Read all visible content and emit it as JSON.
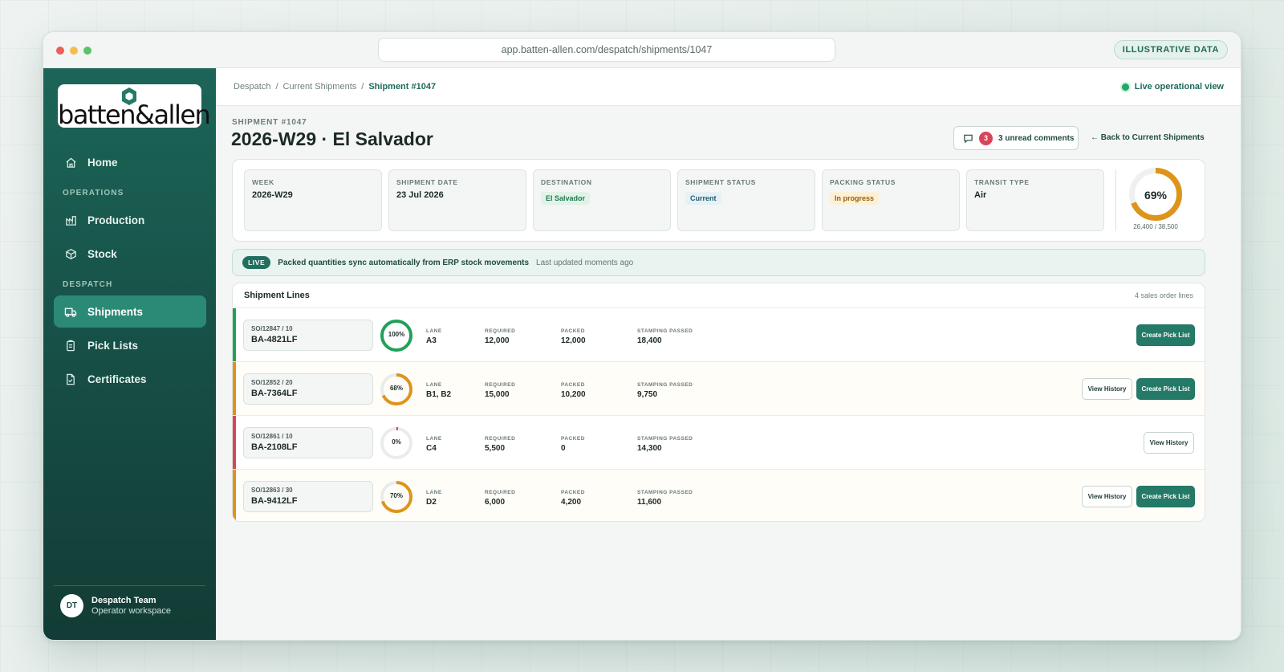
{
  "browser": {
    "url": "app.batten-allen.com/despatch/shipments/1047",
    "badge": "ILLUSTRATIVE DATA"
  },
  "brand": {
    "logo_text": "batten&allen",
    "accent": "#247a66"
  },
  "sidebar": {
    "items": [
      {
        "label": "Home",
        "icon": "home-icon"
      },
      {
        "label": "Production",
        "icon": "factory-icon"
      },
      {
        "label": "Stock",
        "icon": "box-icon"
      },
      {
        "label": "Shipments",
        "icon": "truck-icon",
        "active": true
      },
      {
        "label": "Pick Lists",
        "icon": "clipboard-icon"
      },
      {
        "label": "Certificates",
        "icon": "certificate-icon"
      }
    ],
    "sections": {
      "operations": "OPERATIONS",
      "despatch": "DESPATCH"
    },
    "user": {
      "initials": "DT",
      "name": "Despatch Team",
      "role": "Operator workspace"
    }
  },
  "topbar": {
    "breadcrumb": [
      "Despatch",
      "Current Shipments",
      "Shipment #1047"
    ],
    "live_view": "Live operational view"
  },
  "shipment": {
    "label": "SHIPMENT #1047",
    "title": "2026-W29 · El Salvador",
    "comments_count": "3",
    "comments_label": "3 unread comments",
    "back_label": "← Back to Current Shipments",
    "info": {
      "week_key": "WEEK",
      "week": "2026-W29",
      "date_key": "SHIPMENT DATE",
      "date": "23 Jul 2026",
      "dest_key": "DESTINATION",
      "dest": "El Salvador",
      "status_key": "SHIPMENT STATUS",
      "status": "Current",
      "packing_key": "PACKING STATUS",
      "packing": "In progress",
      "transit_key": "TRANSIT TYPE",
      "transit": "Air"
    },
    "progress": {
      "percent_label": "69%",
      "percent": 0.69,
      "detail": "26,400 / 38,500"
    }
  },
  "live_banner": {
    "pill": "LIVE",
    "message": "Packed quantities sync automatically from ERP stock movements",
    "updated": "Last updated moments ago"
  },
  "lines": {
    "title": "Shipment Lines",
    "count": "4 sales order lines",
    "headers": {
      "lane": "LANE",
      "required": "REQUIRED",
      "packed": "PACKED",
      "stamping": "STAMPING PASSED"
    },
    "view_history": "View History",
    "create_pick": "Create Pick List",
    "rows": [
      {
        "so": "SO/12847 / 10",
        "code": "BA-4821LF",
        "pct_label": "100%",
        "pct": 1.0,
        "lane": "A3",
        "required": "12,000",
        "packed": "12,000",
        "stamping": "18,400",
        "color": "#22a05a",
        "bg": "#ffffff"
      },
      {
        "so": "SO/12852 / 20",
        "code": "BA-7364LF",
        "pct_label": "68%",
        "pct": 0.68,
        "lane": "B1, B2",
        "required": "15,000",
        "packed": "10,200",
        "stamping": "9,750",
        "color": "#de941b",
        "bg": "#fffdf8"
      },
      {
        "so": "SO/12861 / 10",
        "code": "BA-2108LF",
        "pct_label": "0%",
        "pct": 0.0,
        "lane": "C4",
        "required": "5,500",
        "packed": "0",
        "stamping": "14,300",
        "color": "#d7455a",
        "bg": "#ffffff"
      },
      {
        "so": "SO/12863 / 30",
        "code": "BA-9412LF",
        "pct_label": "70%",
        "pct": 0.7,
        "lane": "D2",
        "required": "6,000",
        "packed": "4,200",
        "stamping": "11,600",
        "color": "#de941b",
        "bg": "#fffdf8"
      }
    ]
  }
}
